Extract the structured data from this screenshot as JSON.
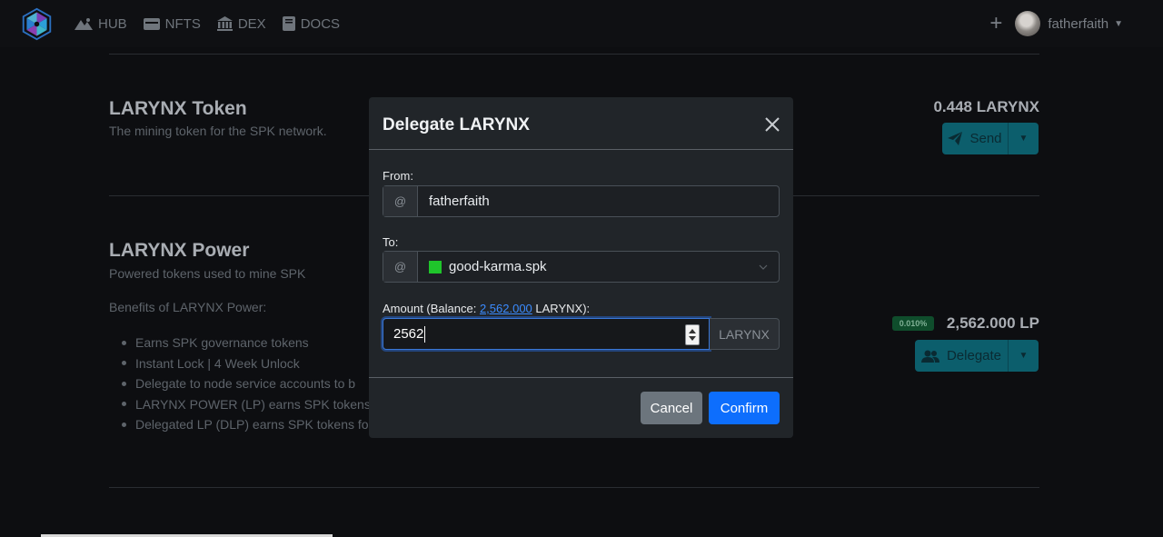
{
  "nav": {
    "links": [
      {
        "label": "HUB",
        "icon": "mountain-icon"
      },
      {
        "label": "NFTS",
        "icon": "wallet-icon"
      },
      {
        "label": "DEX",
        "icon": "bank-icon"
      },
      {
        "label": "DOCS",
        "icon": "book-icon"
      }
    ],
    "plus": "+",
    "username": "fatherfaith"
  },
  "token_section": {
    "title": "LARYNX Token",
    "subtitle": "The mining token for the SPK network.",
    "balance": "0.448 LARYNX",
    "button_label": "Send"
  },
  "power_section": {
    "title": "LARYNX Power",
    "subtitle": "Powered tokens used to mine SPK",
    "benefits_heading": "Benefits of LARYNX Power:",
    "benefits": [
      "Earns SPK governance tokens",
      "Instant Lock | 4 Week Unlock",
      "Delegate to node service accounts to b",
      "LARYNX POWER (LP) earns SPK tokens",
      "Delegated LP (DLP) earns SPK tokens fo"
    ],
    "badge": "0.010%",
    "balance": "2,562.000 LP",
    "button_label": "Delegate"
  },
  "modal": {
    "title": "Delegate LARYNX",
    "from_label": "From:",
    "from_prefix": "@",
    "from_value": "fatherfaith",
    "to_label": "To:",
    "to_prefix": "@",
    "to_value": "good-karma.spk",
    "amount_label_prefix": "Amount (Balance: ",
    "amount_balance": "2,562.000",
    "amount_label_suffix": " LARYNX):",
    "amount_value": "2562",
    "amount_unit": "LARYNX",
    "cancel_label": "Cancel",
    "confirm_label": "Confirm"
  },
  "colors": {
    "accent_teal": "#0c5e6c",
    "confirm_blue": "#0d6efd",
    "cancel_gray": "#6c757d",
    "status_green": "#1fc52b"
  }
}
